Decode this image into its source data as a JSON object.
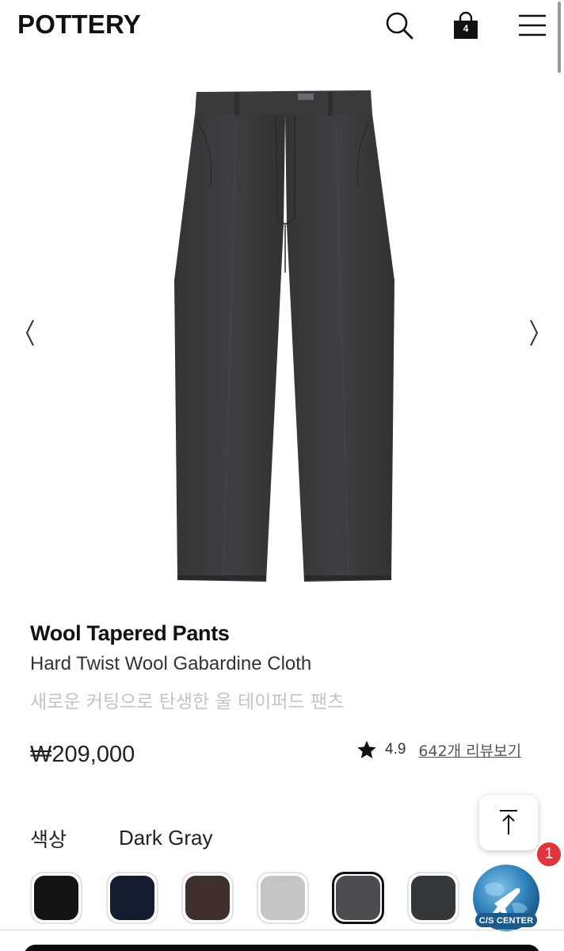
{
  "header": {
    "logo": "POTTERY",
    "cart_count": "4"
  },
  "product": {
    "name": "Wool Tapered Pants",
    "subname": "Hard Twist Wool Gabardine Cloth",
    "korean_description": "새로운 커팅으로 탄생한 울 테이퍼드 팬츠",
    "price": "₩209,000",
    "rating": "4.9",
    "reviews_link": "642개 리뷰보기"
  },
  "color": {
    "label": "색상",
    "selected": "Dark Gray",
    "swatches": [
      "#141414",
      "#141c30",
      "#3f302d",
      "#c5c5c5",
      "#4b4d50",
      "#35383b"
    ],
    "selected_index": 4
  },
  "cs_center": {
    "label": "C/S CENTER",
    "notification_count": "1"
  },
  "icons": {
    "search": "search-icon",
    "cart": "shopping-bag-icon",
    "menu": "hamburger-menu-icon",
    "prev": "chevron-left-icon",
    "next": "chevron-right-icon",
    "star": "star-icon",
    "scroll_top": "arrow-up-to-top-icon",
    "cs": "airplane-globe-icon"
  },
  "colors": {
    "accent": "#111111",
    "notification": "#e0353d",
    "muted_text": "#c4c4c4"
  }
}
